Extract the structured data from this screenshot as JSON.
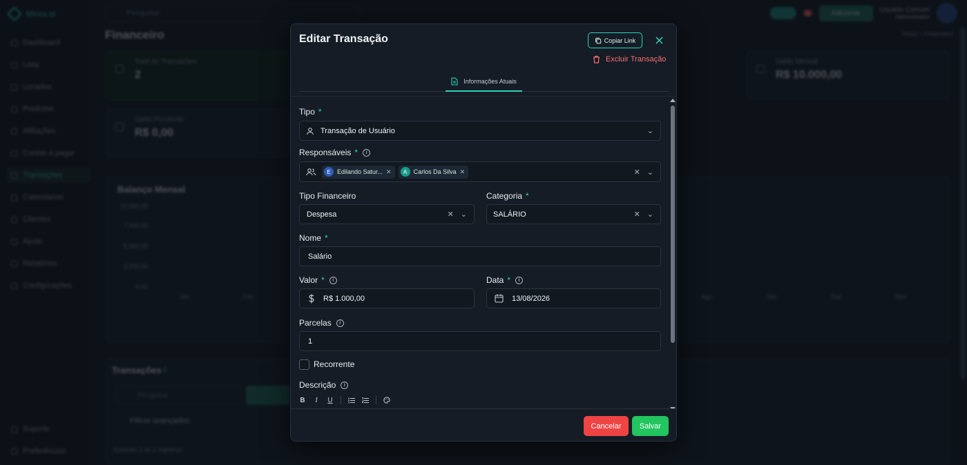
{
  "background": {
    "app_name": "Mesa.ai",
    "search_placeholder": "Pesquisar",
    "page_title": "Financeiro",
    "user_name": "Usuário Comum",
    "user_role": "Administrador",
    "notification_count": "1",
    "header_button": "Adicionar",
    "breadcrumb": "Início > Financeiro",
    "nav": [
      {
        "label": "Dashboard"
      },
      {
        "label": "Lista"
      },
      {
        "label": "Locados"
      },
      {
        "label": "Produtos"
      },
      {
        "label": "Afiliações"
      },
      {
        "label": "Contas a pagar"
      },
      {
        "label": "Transações"
      },
      {
        "label": "Calendários"
      },
      {
        "label": "Clientes"
      },
      {
        "label": "Ajuda"
      },
      {
        "label": "Relatórios"
      },
      {
        "label": "Configurações"
      },
      {
        "label": "Suporte"
      },
      {
        "label": "Preferências"
      }
    ],
    "cards": [
      {
        "label": "Total de Transações",
        "value": "2"
      },
      {
        "label": "Saldo Mensal",
        "value": "R$ 10.000,00"
      },
      {
        "label": "Saldo Pendente",
        "value": "R$ 0,00"
      }
    ],
    "chart_title": "Balanço Mensal",
    "chart_yticks": [
      "10.000,00",
      "7.500,00",
      "5.000,00",
      "2.500,00",
      "0,00"
    ],
    "chart_xticks": [
      "Jan",
      "Fev",
      "Ago",
      "Set",
      "Out",
      "Nov",
      "Dez"
    ],
    "transactions_title": "Transações",
    "transactions_count": "2",
    "filter_placeholder": "Pesquisar",
    "filter_label": "Filtros avançados",
    "footer_text": "Exibindo 2 de 2 registros"
  },
  "modal": {
    "title": "Editar Transação",
    "copy_link": "Copiar Link",
    "delete": "Excluir Transação",
    "tab_current": "Informações Atuais",
    "fields": {
      "tipo_label": "Tipo",
      "tipo_value": "Transação de Usuário",
      "responsaveis_label": "Responsáveis",
      "responsaveis": [
        {
          "initial": "E",
          "name": "Edilando Satur...",
          "color": "#2f5bb7"
        },
        {
          "initial": "A",
          "name": "Carlos Da Silva",
          "color": "#2dd4bf"
        }
      ],
      "tipo_financeiro_label": "Tipo Financeiro",
      "tipo_financeiro_value": "Despesa",
      "categoria_label": "Categoria",
      "categoria_value": "SALÁRIO",
      "nome_label": "Nome",
      "nome_value": "Salário",
      "valor_label": "Valor",
      "valor_value": "R$ 1.000,00",
      "data_label": "Data",
      "data_value": "13/08/2026",
      "parcelas_label": "Parcelas",
      "parcelas_value": "1",
      "recorrente_label": "Recorrente",
      "descricao_label": "Descrição",
      "required_mark": "*"
    },
    "cancel": "Cancelar",
    "save": "Salvar"
  },
  "colors": {
    "accent": "#2dd4bf",
    "danger": "#ef4444",
    "success": "#22c55e"
  }
}
